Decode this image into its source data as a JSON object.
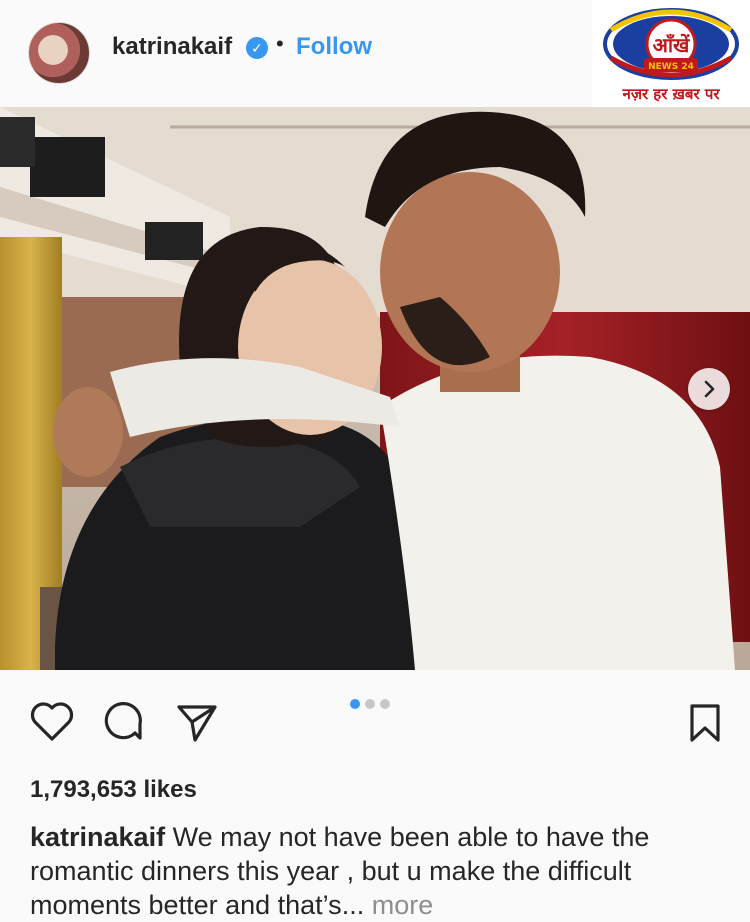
{
  "post": {
    "username": "katrinakaif",
    "separator": "•",
    "follow_label": "Follow",
    "likes": "1,793,653 likes",
    "caption_text": "We may not have been able to have the romantic dinners this year , but u make the difficult moments better and that’s",
    "caption_ellipsis": "...",
    "more_label": "more",
    "carousel": {
      "total": 3,
      "current": 1
    }
  },
  "watermark": {
    "logo_title": "आँखें",
    "logo_sub": "NEWS 24",
    "tagline": "नज़र हर ख़बर पर",
    "colors": {
      "blue": "#1a3fa0",
      "red": "#c0191d",
      "yellow": "#f5c400"
    }
  },
  "icons": {
    "avatar": "profile-picture",
    "verified": "verified-badge-icon",
    "like": "heart-icon",
    "comment": "comment-bubble-icon",
    "share": "paper-plane-icon",
    "save": "bookmark-icon",
    "next": "chevron-right-icon"
  },
  "colors": {
    "accent": "#3897f0",
    "text": "#262626",
    "muted": "#8e8e8e",
    "background": "#fafafa"
  }
}
